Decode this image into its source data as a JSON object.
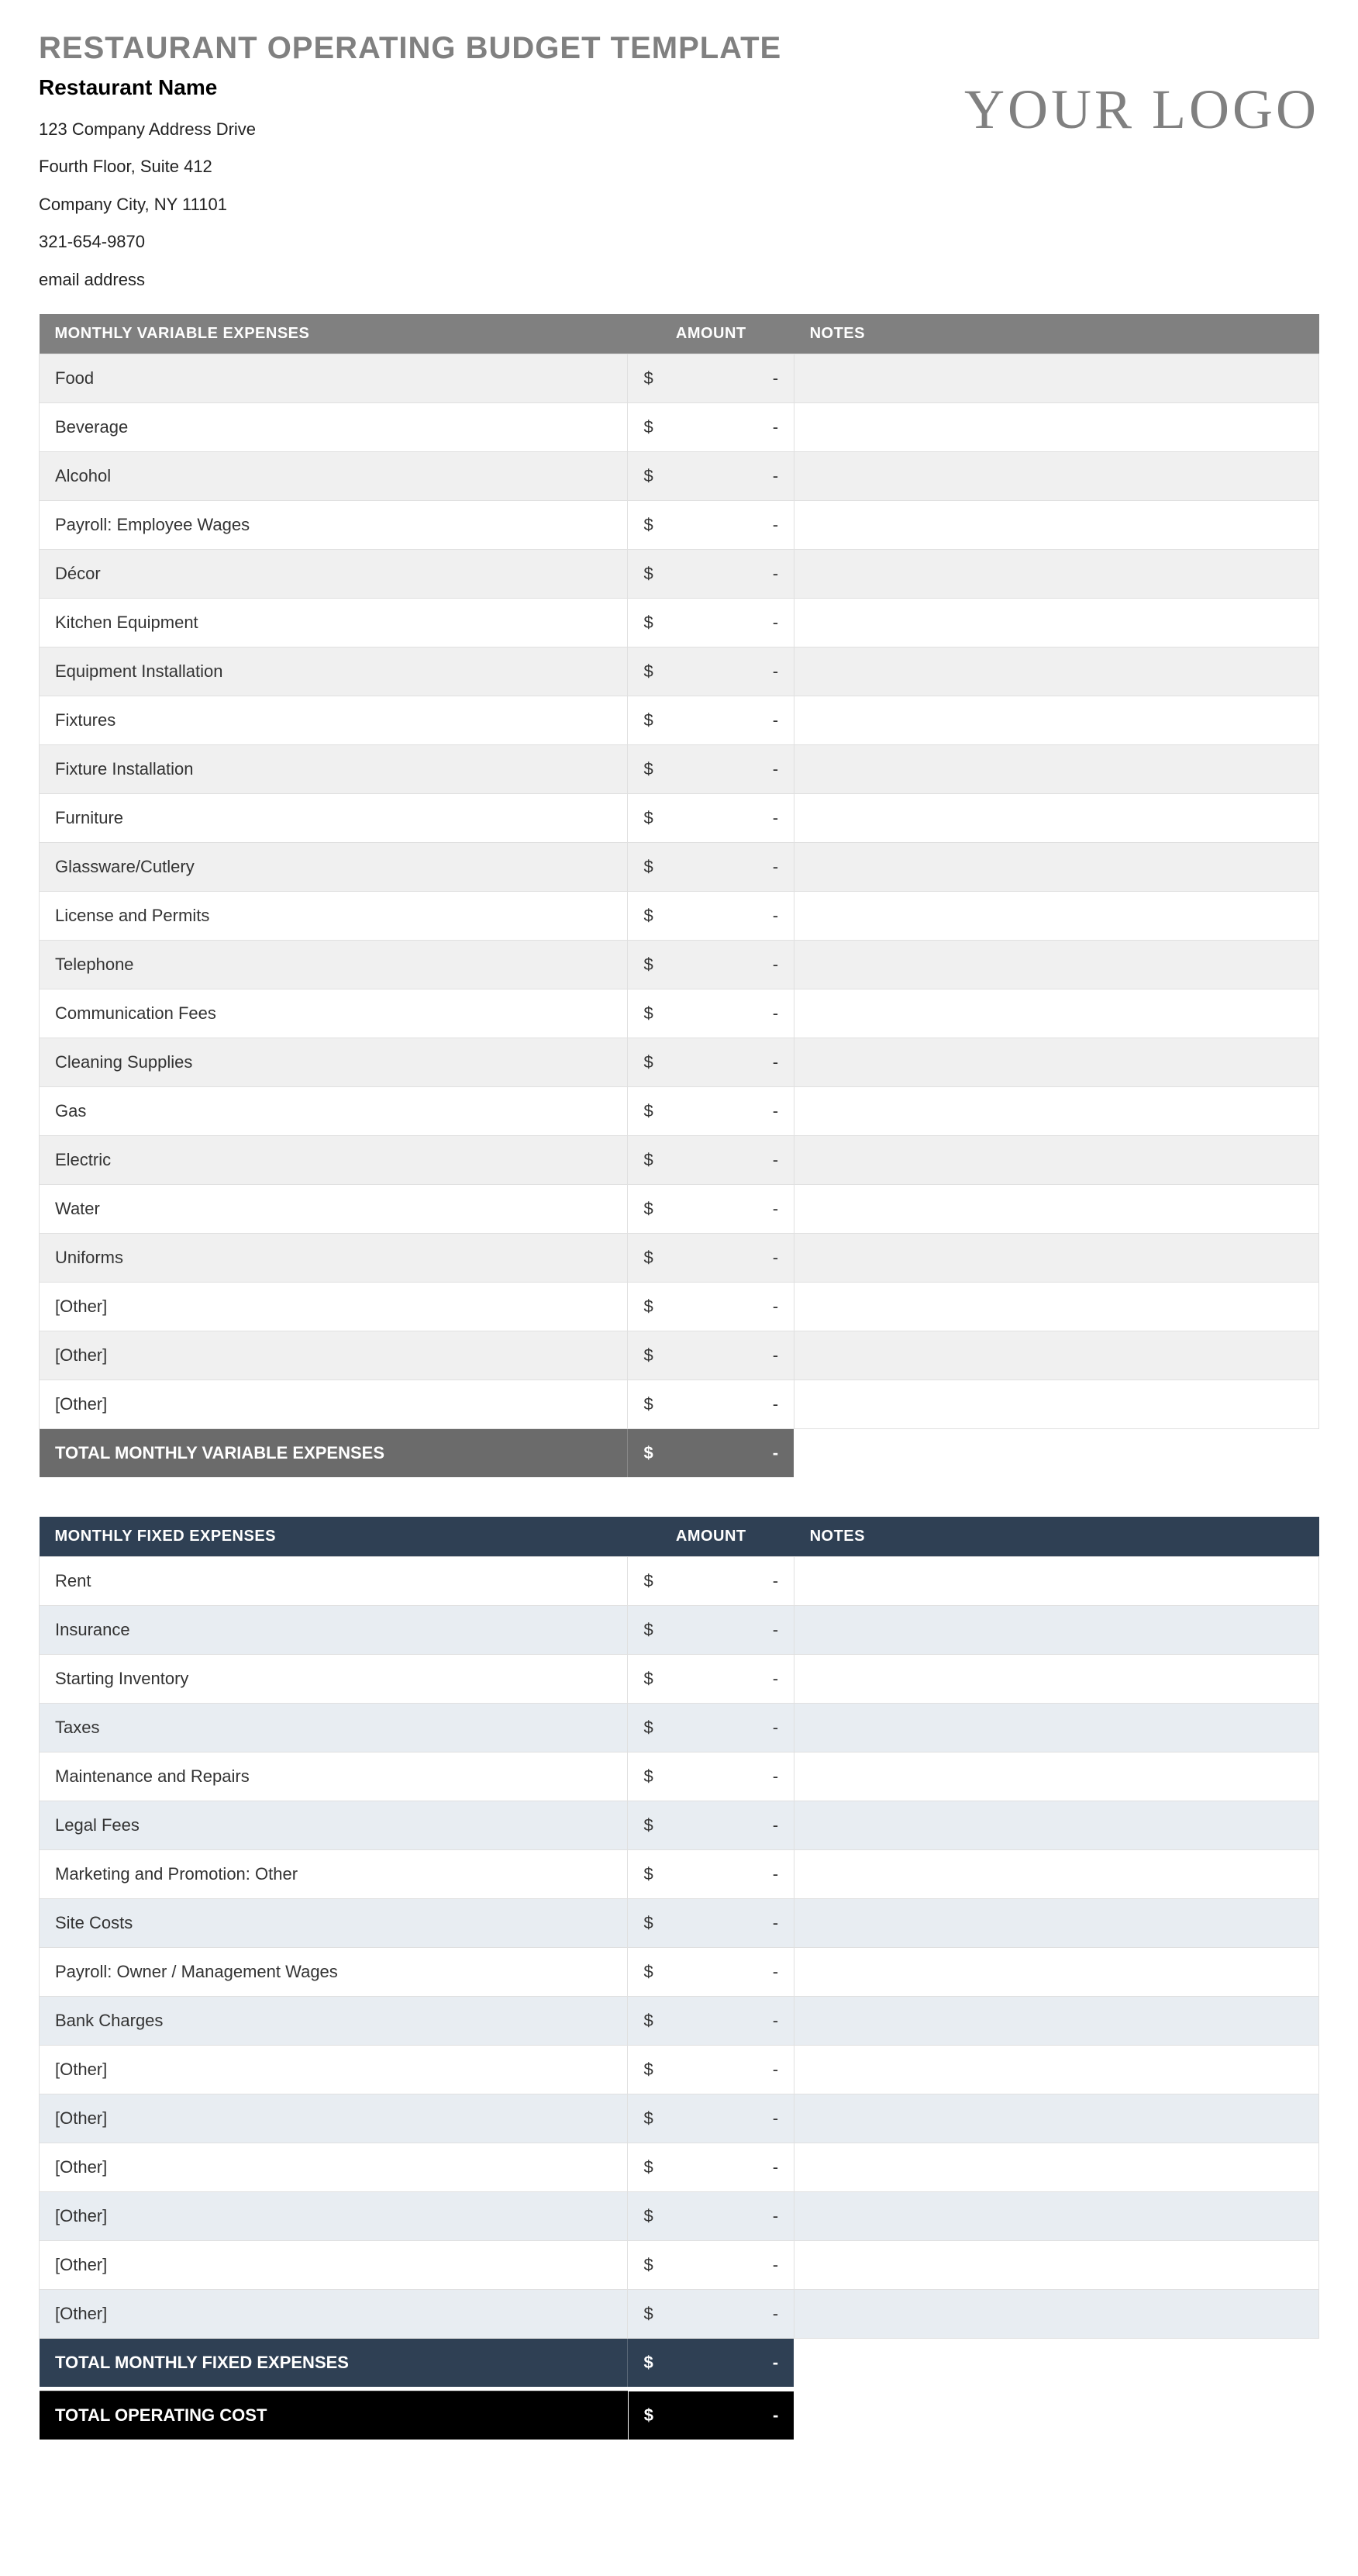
{
  "title": "RESTAURANT OPERATING BUDGET TEMPLATE",
  "company": {
    "name": "Restaurant Name",
    "addr1": "123 Company Address Drive",
    "addr2": "Fourth Floor, Suite 412",
    "city": "Company City, NY  11101",
    "phone": "321-654-9870",
    "email": "email address"
  },
  "logo_text": "YOUR LOGO",
  "currency": "$",
  "dash": "-",
  "headers": {
    "amount": "AMOUNT",
    "notes": "NOTES"
  },
  "sections": {
    "variable": {
      "title": "MONTHLY VARIABLE EXPENSES",
      "rows": [
        "Food",
        "Beverage",
        "Alcohol",
        "Payroll: Employee Wages",
        "Décor",
        "Kitchen Equipment",
        "Equipment Installation",
        "Fixtures",
        "Fixture Installation",
        "Furniture",
        "Glassware/Cutlery",
        "License and Permits",
        "Telephone",
        "Communication Fees",
        "Cleaning Supplies",
        "Gas",
        "Electric",
        "Water",
        "Uniforms",
        "[Other]",
        "[Other]",
        "[Other]"
      ],
      "total_label": "TOTAL MONTHLY VARIABLE EXPENSES"
    },
    "fixed": {
      "title": "MONTHLY FIXED EXPENSES",
      "rows": [
        "Rent",
        "Insurance",
        "Starting Inventory",
        "Taxes",
        "Maintenance and Repairs",
        "Legal Fees",
        "Marketing and Promotion: Other",
        "Site Costs",
        "Payroll: Owner / Management Wages",
        "Bank Charges",
        "[Other]",
        "[Other]",
        "[Other]",
        "[Other]",
        "[Other]",
        "[Other]"
      ],
      "total_label": "TOTAL MONTHLY FIXED EXPENSES"
    },
    "operating_total": "TOTAL OPERATING COST"
  }
}
